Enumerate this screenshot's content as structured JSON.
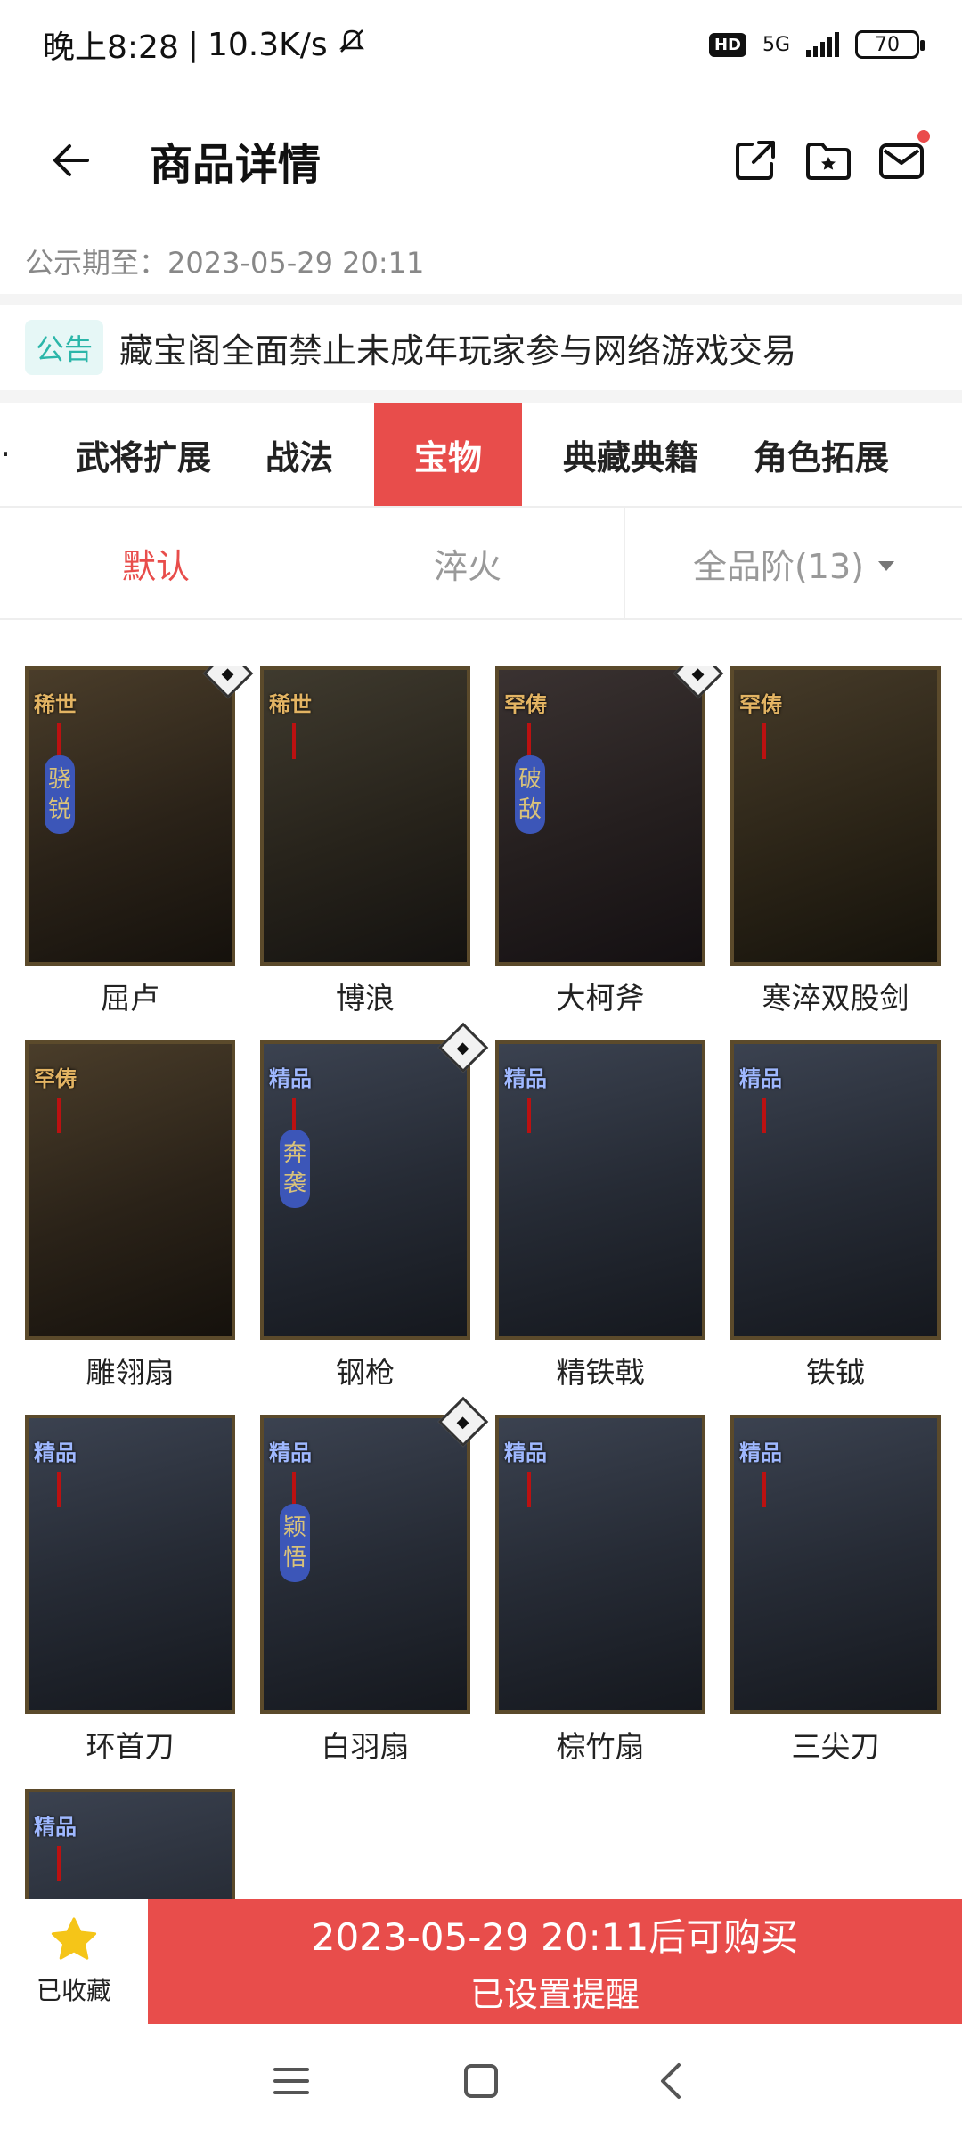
{
  "status": {
    "time": "晚上8:28",
    "speed": "10.3K/s",
    "hd": "HD",
    "network": "5G",
    "battery": "70"
  },
  "header": {
    "title": "商品详情"
  },
  "publicity": {
    "text": "公示期至：2023-05-29 20:11"
  },
  "notice": {
    "tag": "公告",
    "text": "藏宝阁全面禁止未成年玩家参与网络游戏交易"
  },
  "category_tabs": [
    {
      "label": "武将扩展"
    },
    {
      "label": "战法"
    },
    {
      "label": "宝物",
      "active": true
    },
    {
      "label": "典藏典籍"
    },
    {
      "label": "角色拓展"
    }
  ],
  "sort": {
    "default": "默认",
    "quench": "淬火",
    "grade": "全品阶(13)"
  },
  "items": [
    {
      "name": "屈卢",
      "tier": "稀世",
      "ribbon": "骁锐",
      "corner": true
    },
    {
      "name": "博浪",
      "tier": "稀世",
      "ribbon": "",
      "corner": false
    },
    {
      "name": "大柯斧",
      "tier": "罕俦",
      "ribbon": "破敌",
      "corner": true
    },
    {
      "name": "寒淬双股剑",
      "tier": "罕俦",
      "ribbon": "",
      "corner": false
    },
    {
      "name": "雕翎扇",
      "tier": "罕俦",
      "ribbon": "",
      "corner": false
    },
    {
      "name": "钢枪",
      "tier": "精品",
      "ribbon": "奔袭",
      "corner": true
    },
    {
      "name": "精铁戟",
      "tier": "精品",
      "ribbon": "",
      "corner": false
    },
    {
      "name": "铁钺",
      "tier": "精品",
      "ribbon": "",
      "corner": false
    },
    {
      "name": "环首刀",
      "tier": "精品",
      "ribbon": "",
      "corner": false
    },
    {
      "name": "白羽扇",
      "tier": "精品",
      "ribbon": "颖悟",
      "corner": true
    },
    {
      "name": "棕竹扇",
      "tier": "精品",
      "ribbon": "",
      "corner": false
    },
    {
      "name": "三尖刀",
      "tier": "精品",
      "ribbon": "",
      "corner": false
    },
    {
      "name": "",
      "tier": "精品",
      "ribbon": "",
      "corner": false
    }
  ],
  "action_bar": {
    "fav_label": "已收藏",
    "buy_main": "2023-05-29 20:11后可购买",
    "buy_sub": "已设置提醒"
  },
  "colors": {
    "accent": "#e84d4b",
    "notice_tag": "#2bb6a9",
    "star": "#f5c518"
  }
}
